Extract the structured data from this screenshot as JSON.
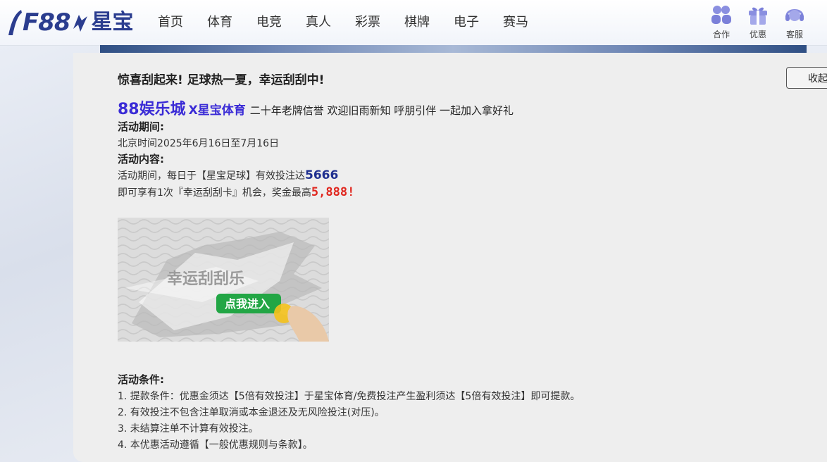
{
  "header": {
    "logo_text": "F88",
    "logo_cn": "星宝",
    "nav": [
      "首页",
      "体育",
      "电竞",
      "真人",
      "彩票",
      "棋牌",
      "电子",
      "赛马"
    ],
    "tools": [
      {
        "label": "合作",
        "icon": "partner-icon"
      },
      {
        "label": "优惠",
        "icon": "gift-icon"
      },
      {
        "label": "客服",
        "icon": "headset-icon"
      }
    ]
  },
  "promo": {
    "title": "惊喜刮起来! 足球热一夏，幸运刮刮中!",
    "collapse_label": "收起",
    "brand_88": "88娱乐城",
    "brand_xbt": "X星宝体育",
    "brand_tagline": "二十年老牌信誉  欢迎旧雨新知  呼朋引伴 一起加入拿好礼",
    "period_label": "活动期间:",
    "period_value": "北京时间2025年6月16日至7月16日",
    "content_label": "活动内容:",
    "content_line1_prefix": "活动期间，每日于【星宝足球】有效投注达",
    "content_line1_amount": "5666",
    "content_line2_prefix": "即可享有1次『幸运刮刮卡』机会，奖金最高",
    "content_line2_amount": "5,888!",
    "card_title": "幸运刮刮乐",
    "card_button": "点我进入",
    "conditions_label": "活动条件:",
    "conditions": [
      "1. 提款条件：优惠金须达【5倍有效投注】于星宝体育/免费投注产生盈利须达【5倍有效投注】即可提款。",
      "2. 有效投注不包含注单取消或本金退还及无风险投注(对压)。",
      "3. 未结算注单不计算有效投注。",
      "4. 本优惠活动遵循【一般优惠规则与条款】。"
    ]
  },
  "colors": {
    "brand_blue": "#2b3d8f",
    "promo_purple": "#3a2bd6",
    "amount_blue": "#1f2f8f",
    "amount_red": "#e0261e",
    "card_green": "#22a645"
  }
}
